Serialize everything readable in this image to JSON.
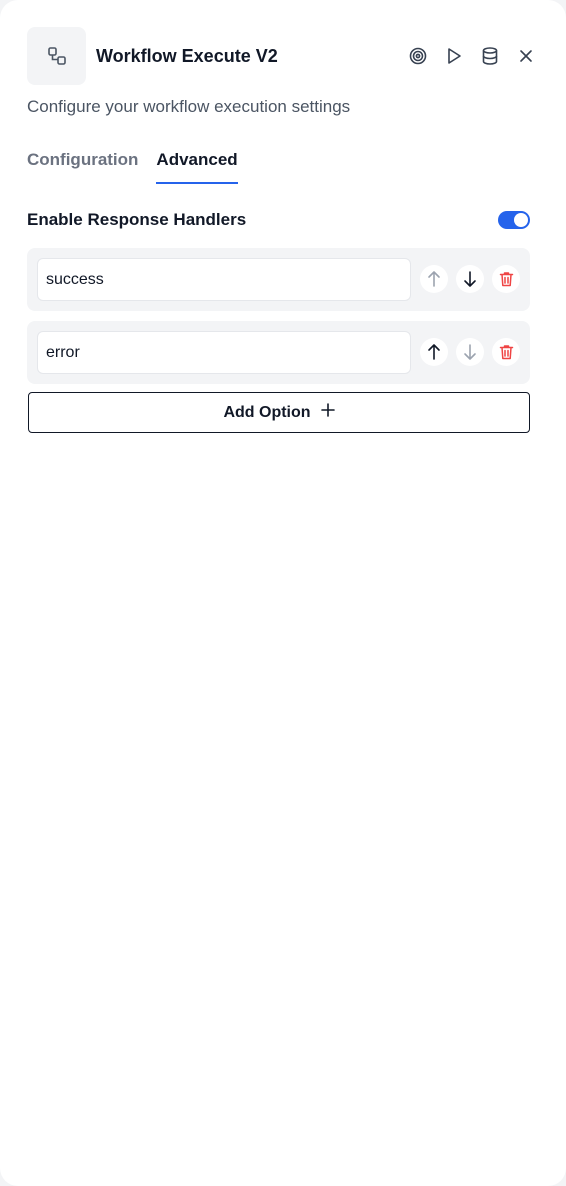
{
  "header": {
    "title": "Workflow Execute V2",
    "subtitle": "Configure your workflow execution settings",
    "node_icon": "workflow-nodes-icon",
    "actions": [
      "target-icon",
      "play-icon",
      "database-icon",
      "close-icon"
    ]
  },
  "tabs": [
    {
      "label": "Configuration",
      "active": false
    },
    {
      "label": "Advanced",
      "active": true
    }
  ],
  "response_handlers": {
    "label": "Enable Response Handlers",
    "enabled": true
  },
  "options": [
    {
      "value": "success",
      "up_enabled": false,
      "down_enabled": true
    },
    {
      "value": "error",
      "up_enabled": true,
      "down_enabled": false
    }
  ],
  "add_option": {
    "label": "Add Option"
  },
  "colors": {
    "accent": "#2563eb",
    "delete": "#ef4444",
    "muted_icon": "#9ca3af",
    "text": "#111827"
  }
}
